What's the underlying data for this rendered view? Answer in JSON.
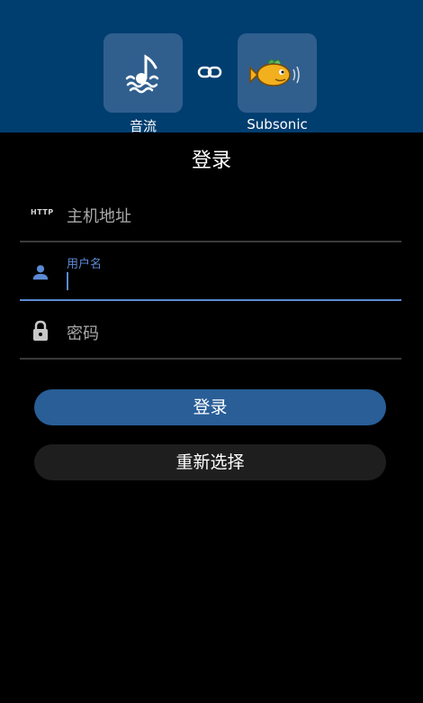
{
  "header": {
    "source_app": {
      "label": "音流",
      "icon": "music-note-waves-icon"
    },
    "link_icon": "link-icon",
    "target_app": {
      "label": "Subsonic",
      "icon": "subsonic-fish-logo"
    }
  },
  "form": {
    "title": "登录",
    "host_field": {
      "badge": "HTTP",
      "placeholder": "主机地址",
      "value": ""
    },
    "username_field": {
      "label": "用户名",
      "value": ""
    },
    "password_field": {
      "placeholder": "密码",
      "value": ""
    }
  },
  "actions": {
    "login_label": "登录",
    "reselect_label": "重新选择"
  },
  "colors": {
    "header_bg": "#003e70",
    "tile_bg": "#305f8e",
    "accent": "#5b8ad4",
    "primary_button": "#295e97",
    "secondary_button": "#1e1e1e"
  }
}
